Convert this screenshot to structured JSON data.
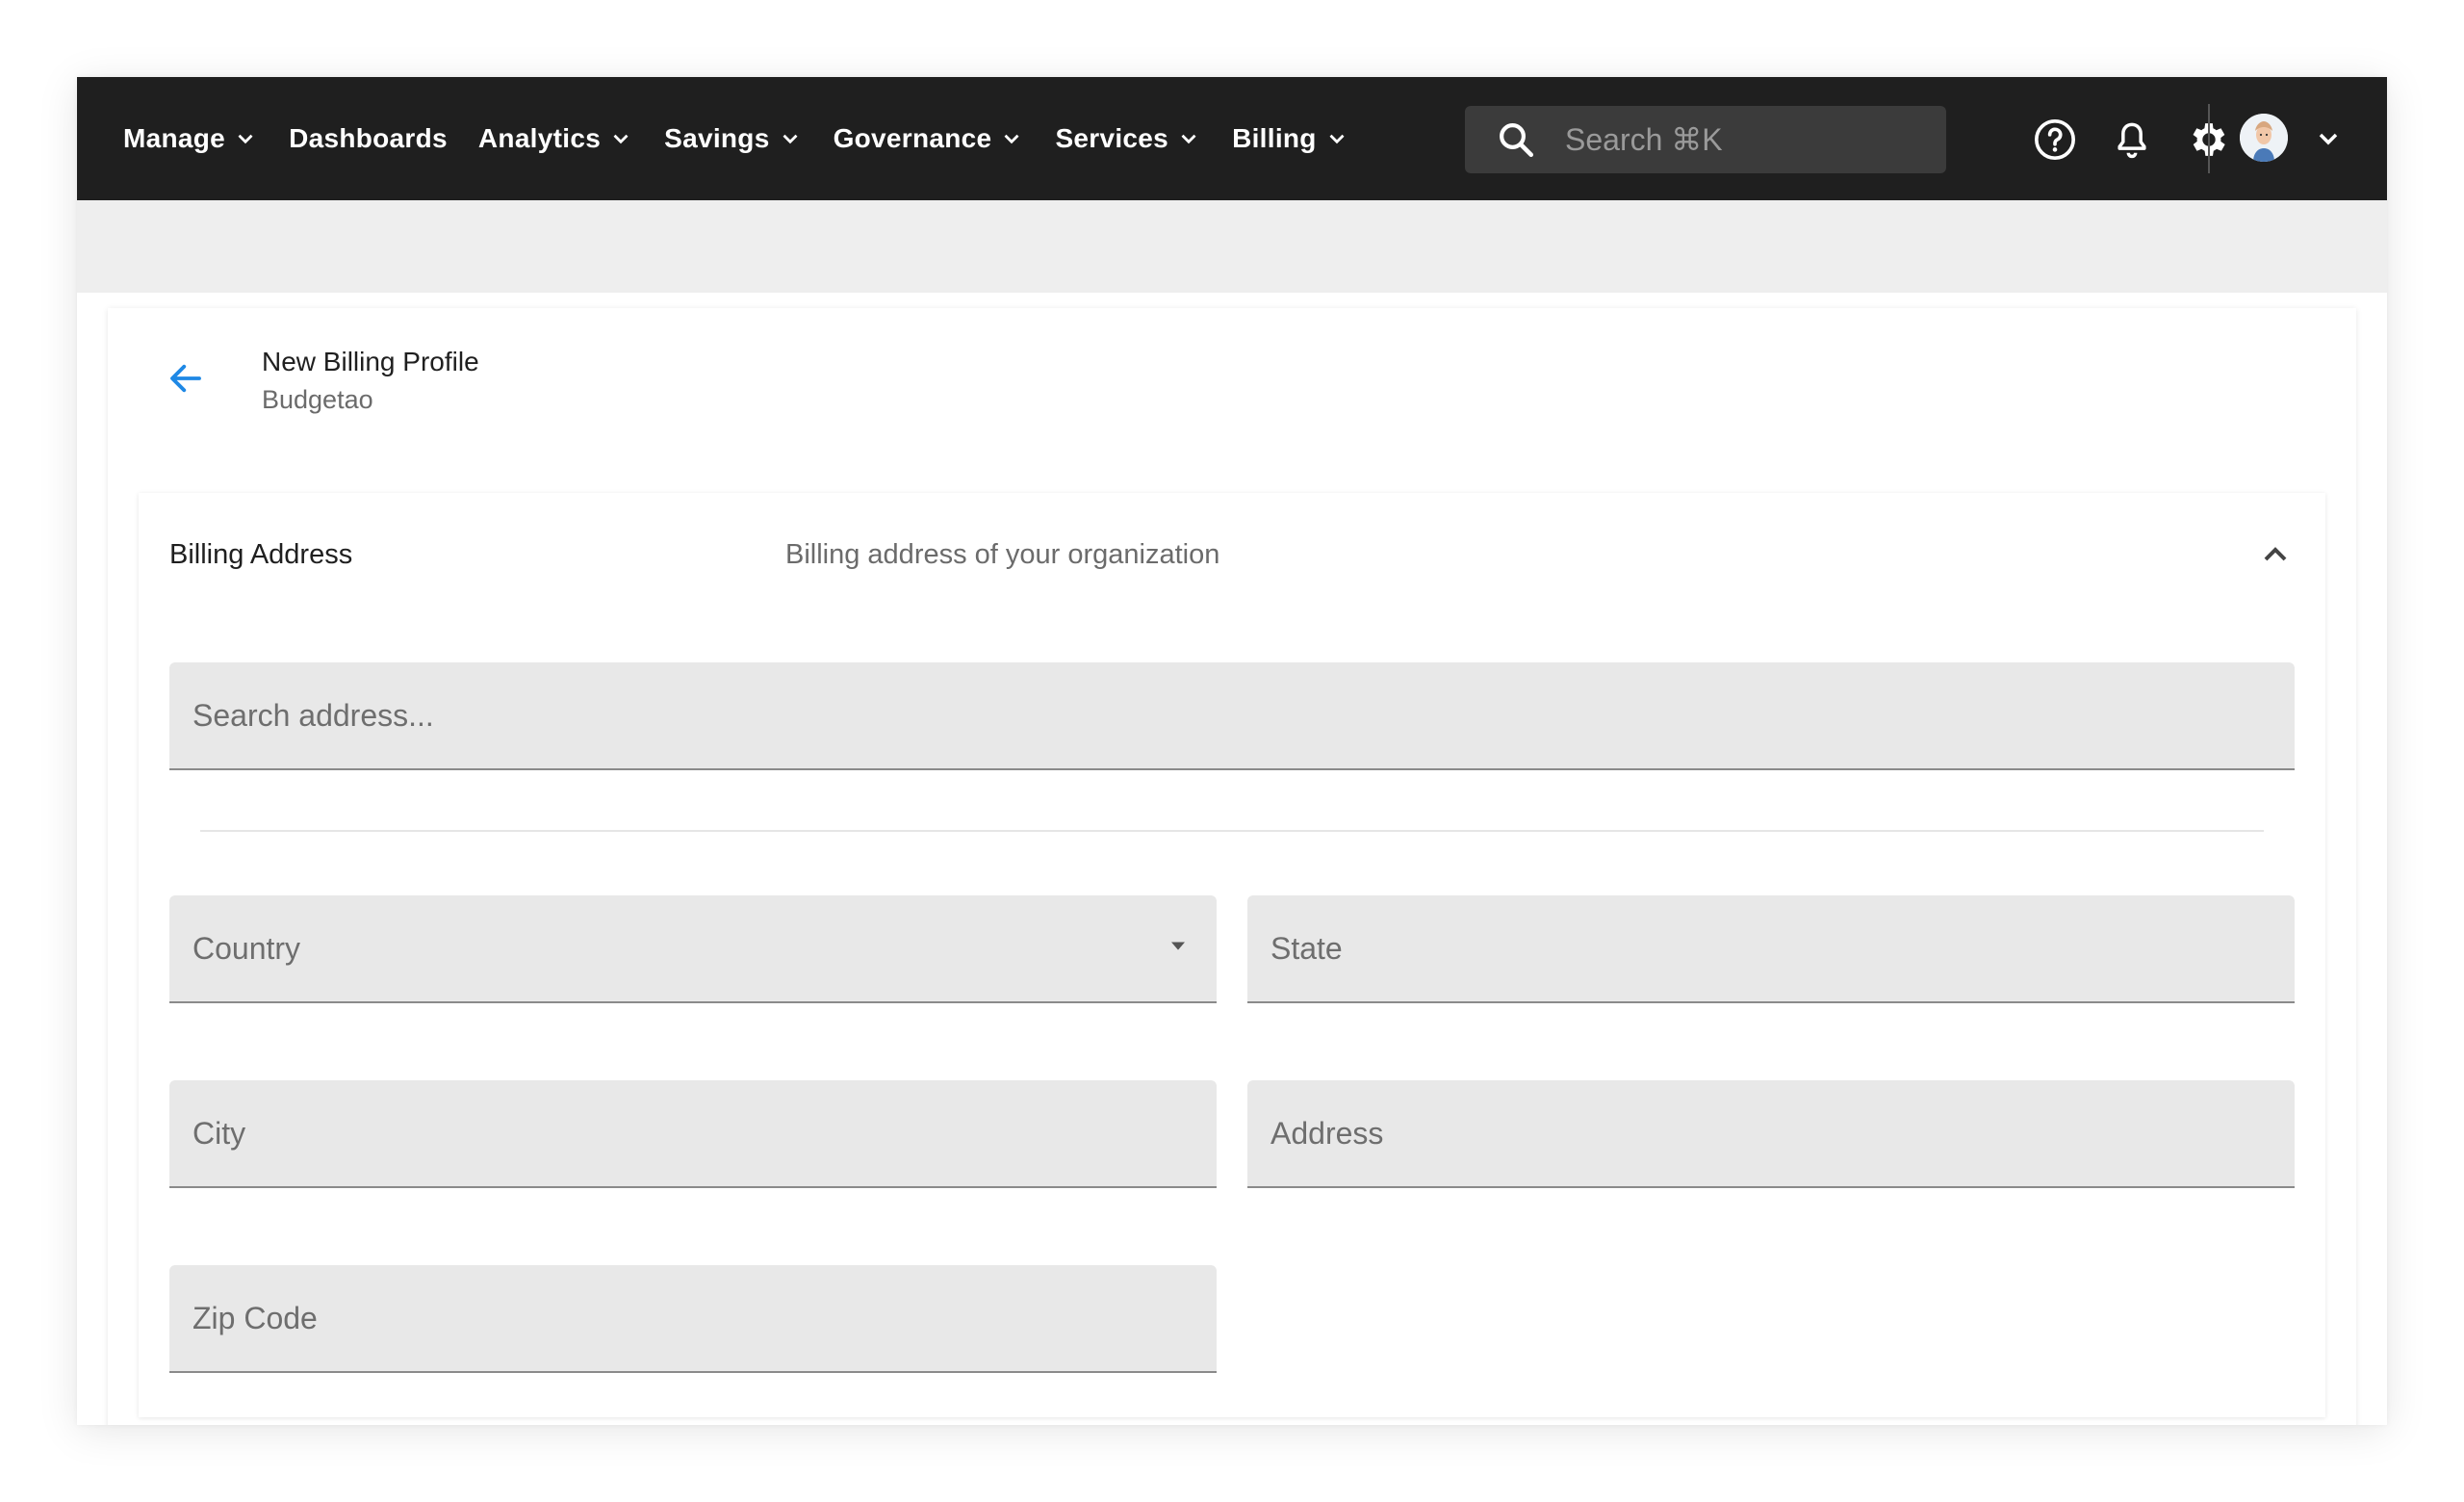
{
  "nav": {
    "items": [
      {
        "label": "Manage",
        "has_menu": true
      },
      {
        "label": "Dashboards",
        "has_menu": false
      },
      {
        "label": "Analytics",
        "has_menu": true
      },
      {
        "label": "Savings",
        "has_menu": true
      },
      {
        "label": "Governance",
        "has_menu": true
      },
      {
        "label": "Services",
        "has_menu": true
      },
      {
        "label": "Billing",
        "has_menu": true
      }
    ],
    "search_placeholder": "Search ⌘K",
    "icons": [
      "help-circle-icon",
      "bell-icon",
      "gear-icon",
      "avatar",
      "chevron-down-icon"
    ]
  },
  "page": {
    "title": "New Billing Profile",
    "subtitle": "Budgetao"
  },
  "billing_address": {
    "title": "Billing Address",
    "description": "Billing address of your organization",
    "search_placeholder": "Search address...",
    "fields": {
      "country": "Country",
      "state": "State",
      "city": "City",
      "address": "Address",
      "zip": "Zip Code"
    }
  },
  "colors": {
    "topbar": "#1f1f1f",
    "accent": "#1e88e5",
    "field_bg": "#e8e8e8"
  }
}
